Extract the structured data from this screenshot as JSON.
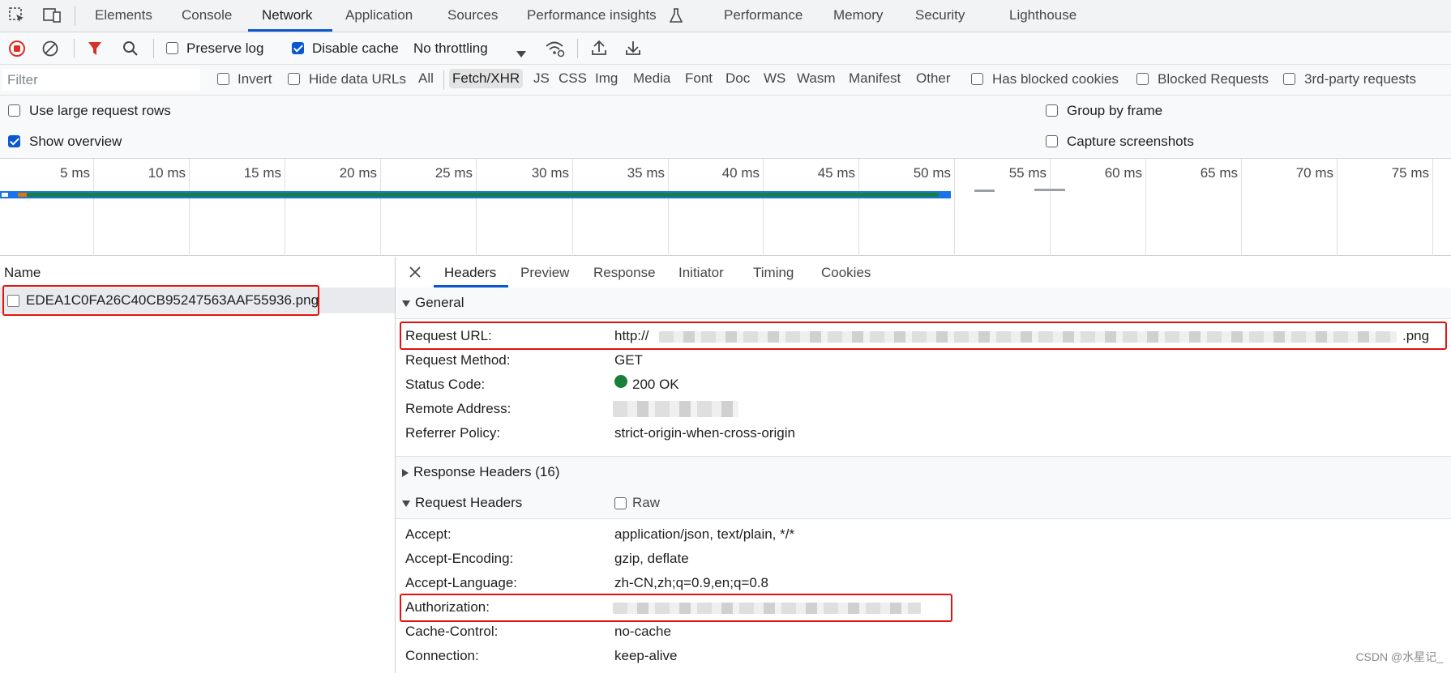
{
  "devtools_tabs": [
    "Elements",
    "Console",
    "Network",
    "Application",
    "Sources",
    "Performance insights",
    "Performance",
    "Memory",
    "Security",
    "Lighthouse"
  ],
  "active_tab": "Network",
  "toolbar": {
    "preserve_log": "Preserve log",
    "disable_cache": "Disable cache",
    "throttling": "No throttling"
  },
  "filterbar": {
    "placeholder": "Filter",
    "invert": "Invert",
    "hide_data_urls": "Hide data URLs",
    "types": [
      "All",
      "Fetch/XHR",
      "JS",
      "CSS",
      "Img",
      "Media",
      "Font",
      "Doc",
      "WS",
      "Wasm",
      "Manifest",
      "Other"
    ],
    "active_type": "Fetch/XHR",
    "has_blocked_cookies": "Has blocked cookies",
    "blocked_requests": "Blocked Requests",
    "third_party": "3rd-party requests"
  },
  "settings": {
    "large_rows": "Use large request rows",
    "show_overview": "Show overview",
    "group_by_frame": "Group by frame",
    "capture_screenshots": "Capture screenshots"
  },
  "overview": {
    "ticks": [
      "5 ms",
      "10 ms",
      "15 ms",
      "20 ms",
      "25 ms",
      "30 ms",
      "35 ms",
      "40 ms",
      "45 ms",
      "50 ms",
      "55 ms",
      "60 ms",
      "65 ms",
      "70 ms",
      "75 ms"
    ],
    "colors": {
      "receiving": "#1a73e8",
      "waiting": "#188038",
      "queue": "#e37400"
    }
  },
  "requests": {
    "name_header": "Name",
    "items": [
      "EDEA1C0FA26C40CB95247563AAF55936.png"
    ]
  },
  "detail": {
    "tabs": [
      "Headers",
      "Preview",
      "Response",
      "Initiator",
      "Timing",
      "Cookies"
    ],
    "active": "Headers",
    "general": {
      "title": "General",
      "request_url_key": "Request URL:",
      "request_url_prefix": "http://",
      "request_url_suffix": ".png",
      "request_method_key": "Request Method:",
      "request_method": "GET",
      "status_code_key": "Status Code:",
      "status_code": "200 OK",
      "remote_address_key": "Remote Address:",
      "referrer_policy_key": "Referrer Policy:",
      "referrer_policy": "strict-origin-when-cross-origin"
    },
    "response_headers": "Response Headers (16)",
    "request_headers": {
      "title": "Request Headers",
      "raw": "Raw",
      "accept_key": "Accept:",
      "accept": "application/json, text/plain, */*",
      "accept_encoding_key": "Accept-Encoding:",
      "accept_encoding": "gzip, deflate",
      "accept_language_key": "Accept-Language:",
      "accept_language": "zh-CN,zh;q=0.9,en;q=0.8",
      "authorization_key": "Authorization:",
      "cache_control_key": "Cache-Control:",
      "cache_control": "no-cache",
      "connection_key": "Connection:",
      "connection": "keep-alive"
    }
  },
  "watermark": "CSDN @水星记_",
  "accent_color": "#0b57d0",
  "highlight_color": "#e3120b",
  "status_ok_color": "#188038"
}
